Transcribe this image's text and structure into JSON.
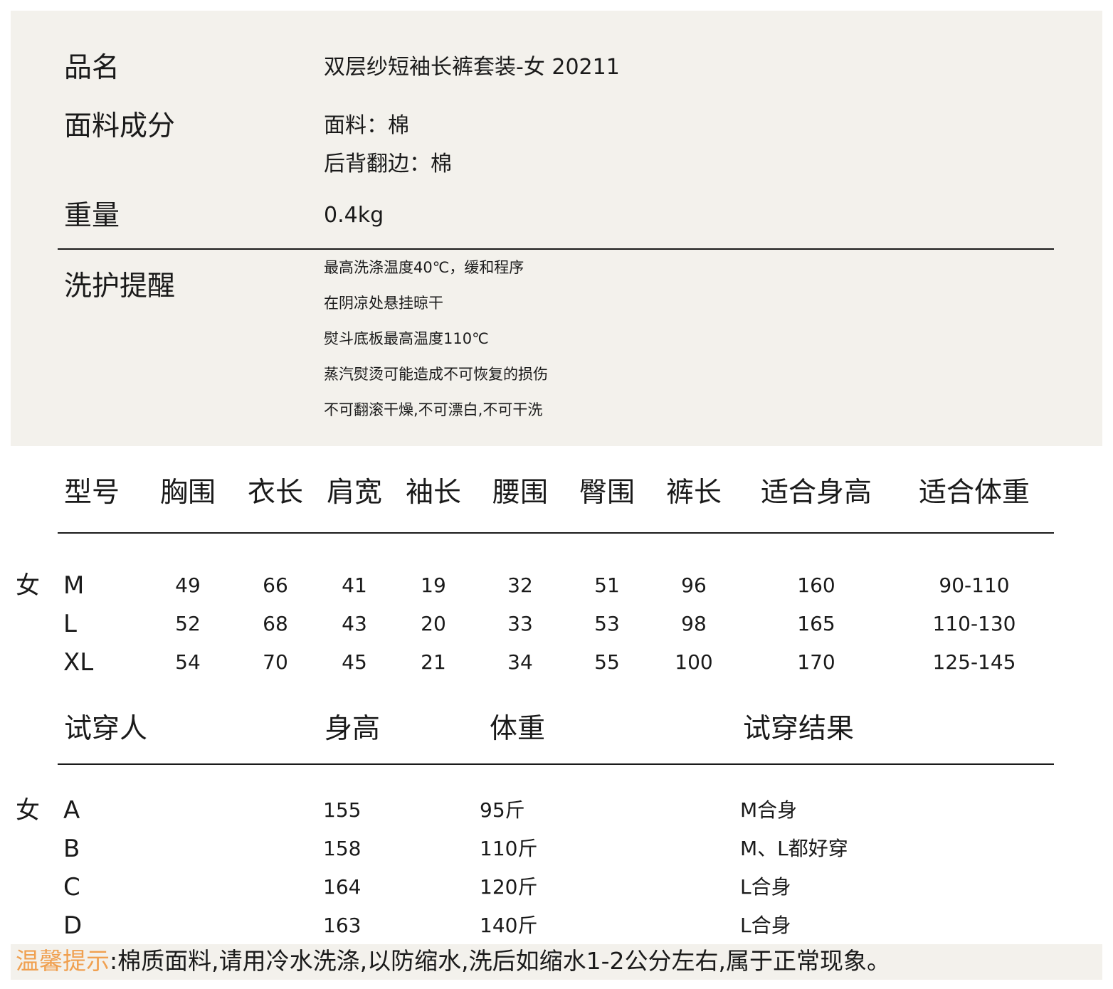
{
  "info": {
    "name_label": "品名",
    "name_value": "双层纱短袖长裤套装-女 20211",
    "fabric_label": "面料成分",
    "fabric_lines": [
      "面料：棉",
      "后背翻边：棉"
    ],
    "weight_label": "重量",
    "weight_value": "0.4kg",
    "care_label": "洗护提醒",
    "care_lines": [
      "最高洗涤温度40℃，缓和程序",
      "在阴凉处悬挂晾干",
      "熨斗底板最高温度110℃",
      "蒸汽熨烫可能造成不可恢复的损伤",
      "不可翻滚干燥,不可漂白,不可干洗"
    ]
  },
  "size_table": {
    "headers": [
      "型号",
      "胸围",
      "衣长",
      "肩宽",
      "袖长",
      "腰围",
      "臀围",
      "裤长",
      "适合身高",
      "适合体重"
    ],
    "gender": "女",
    "rows": [
      [
        "M",
        "49",
        "66",
        "41",
        "19",
        "32",
        "51",
        "96",
        "160",
        "90-110"
      ],
      [
        "L",
        "52",
        "68",
        "43",
        "20",
        "33",
        "53",
        "98",
        "165",
        "110-130"
      ],
      [
        "XL",
        "54",
        "70",
        "45",
        "21",
        "34",
        "55",
        "100",
        "170",
        "125-145"
      ]
    ]
  },
  "fitting_table": {
    "headers": [
      "试穿人",
      "身高",
      "体重",
      "试穿结果"
    ],
    "gender": "女",
    "rows": [
      [
        "A",
        "155",
        "95斤",
        "M合身"
      ],
      [
        "B",
        "158",
        "110斤",
        "M、L都好穿"
      ],
      [
        "C",
        "164",
        "120斤",
        "L合身"
      ],
      [
        "D",
        "163",
        "140斤",
        "L合身"
      ]
    ]
  },
  "footer": {
    "label": "温馨提示",
    "text": ":棉质面料,请用冷水洗涤,以防缩水,洗后如缩水1-2公分左右,属于正常现象。",
    "label_color": "#f0a050"
  }
}
